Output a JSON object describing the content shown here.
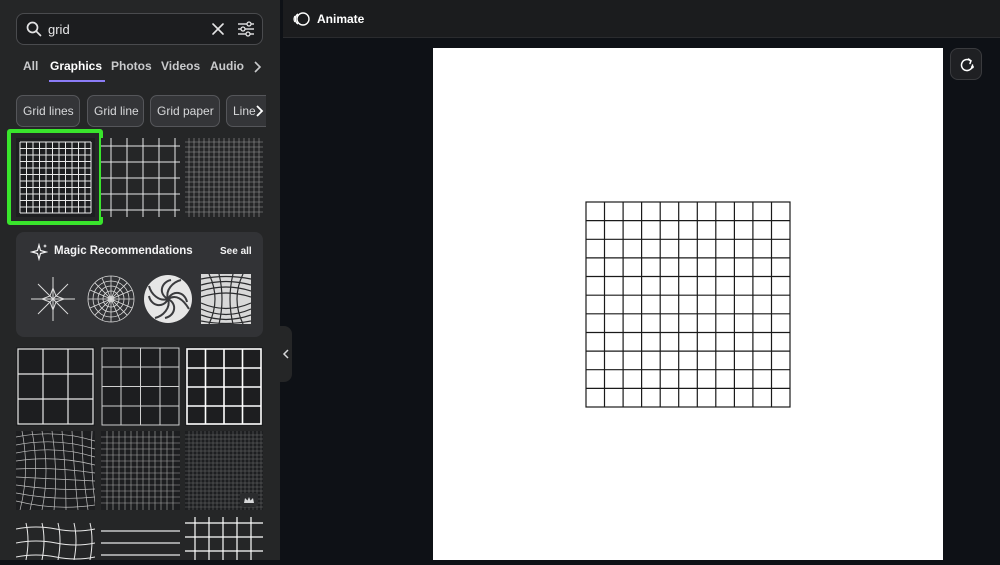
{
  "search": {
    "query": "grid"
  },
  "tabs": [
    {
      "label": "All"
    },
    {
      "label": "Graphics"
    },
    {
      "label": "Photos"
    },
    {
      "label": "Videos"
    },
    {
      "label": "Audio"
    }
  ],
  "active_tab": "Graphics",
  "chips": [
    {
      "label": "Grid lines"
    },
    {
      "label": "Grid line"
    },
    {
      "label": "Grid paper"
    },
    {
      "label": "Line"
    }
  ],
  "magic": {
    "title": "Magic Recommendations",
    "see_all": "See all"
  },
  "toolbar": {
    "animate_label": "Animate"
  },
  "colors": {
    "accent": "#8b7cf6",
    "selection": "#39e52c",
    "sidebar_bg": "#252627",
    "canvas_bg": "#0e1116"
  },
  "icons": [
    "search-icon",
    "clear-icon",
    "filter-icon",
    "chevron-right-icon",
    "sparkle-icon",
    "crown-icon",
    "animate-icon",
    "refresh-icon",
    "collapse-chevron-icon"
  ]
}
